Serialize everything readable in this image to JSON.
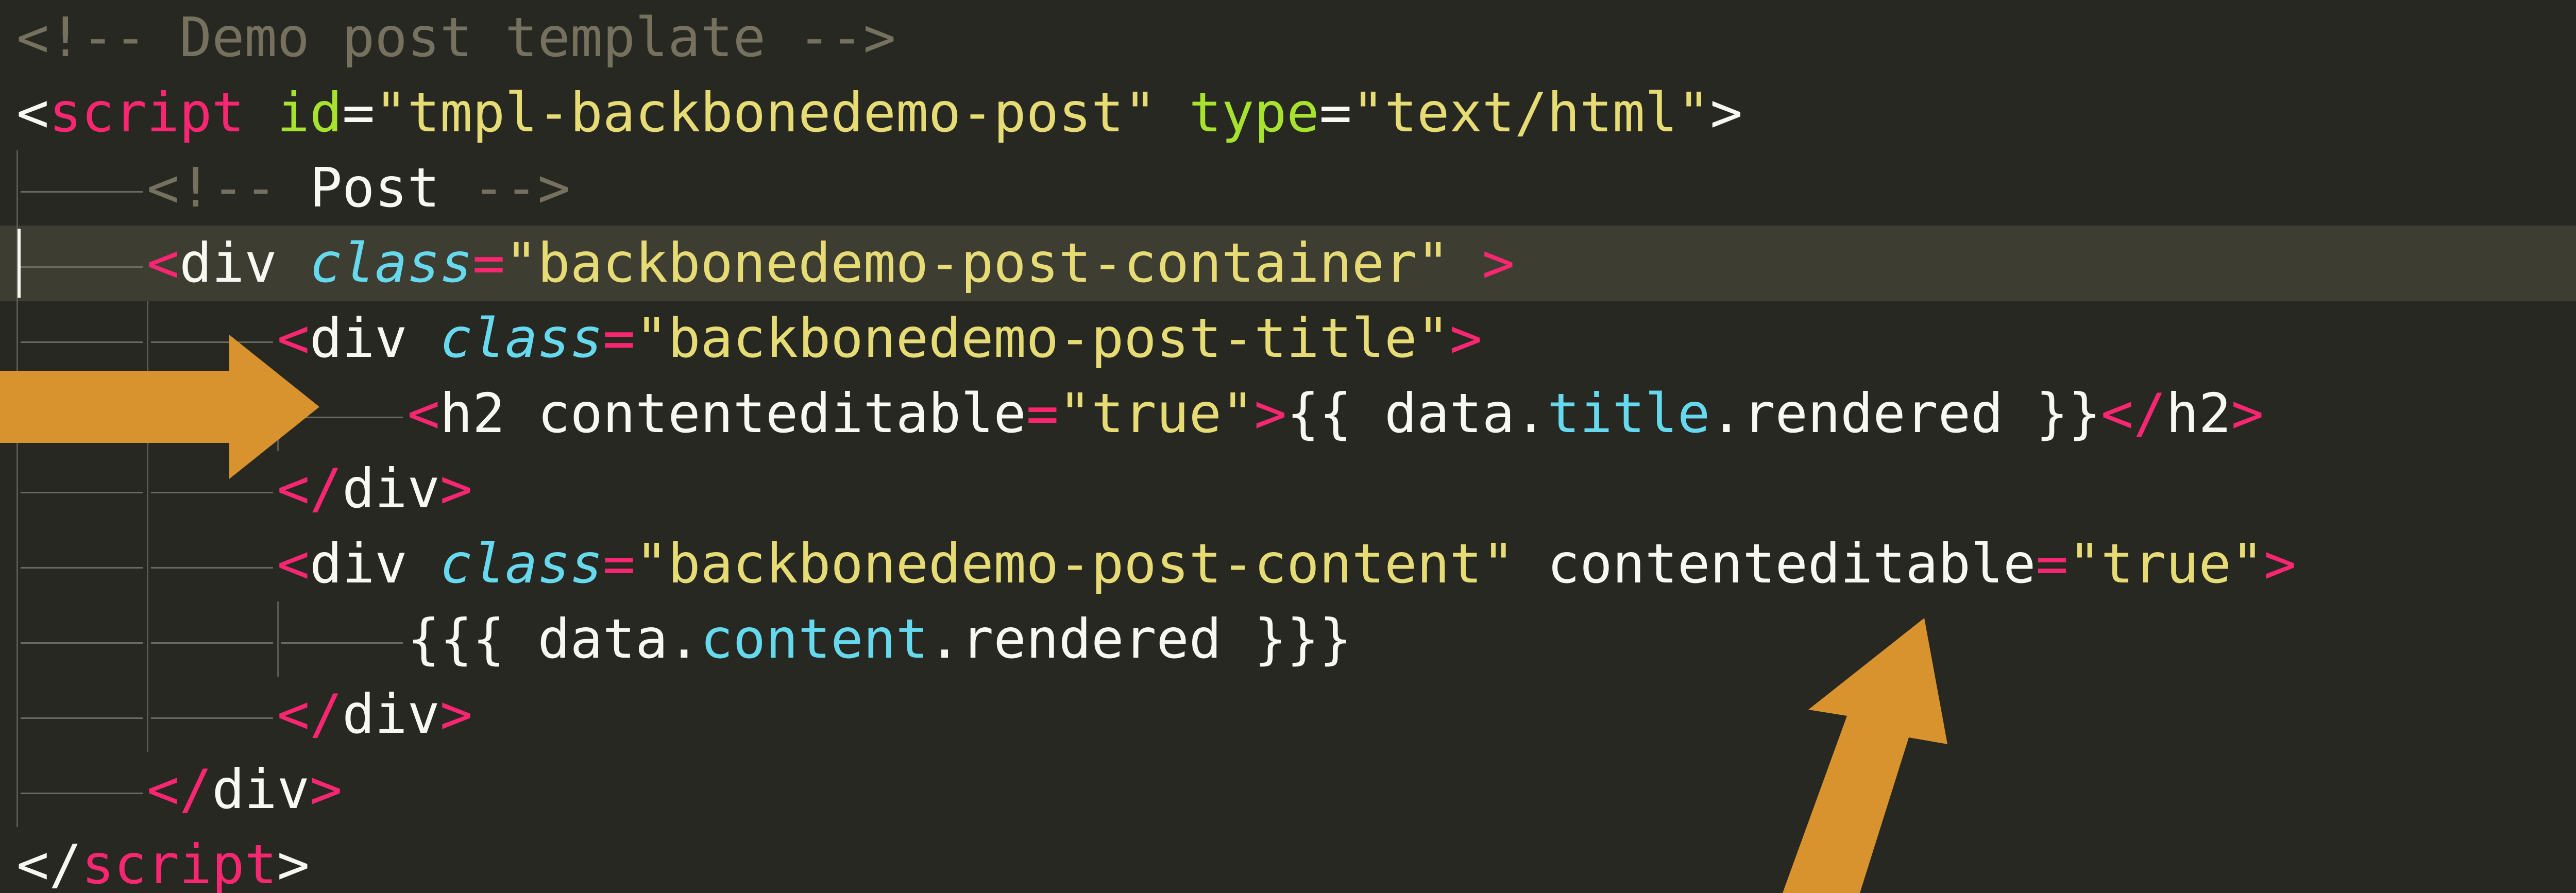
{
  "editor": {
    "theme_colors": {
      "background": "#272822",
      "comment": "#75715e",
      "tag": "#f92672",
      "attribute": "#a6e22e",
      "string": "#e6db74",
      "class_keyword": "#66d9ef",
      "text": "#f8f8f2",
      "annotation_arrow": "#d8922e"
    },
    "lines": [
      {
        "tokens": [
          {
            "t": "cmt",
            "v": "<!-- Demo post template -->"
          }
        ]
      },
      {
        "tokens": [
          {
            "t": "pl",
            "v": "<"
          },
          {
            "t": "tag",
            "v": "script"
          },
          {
            "t": "pl",
            "v": " "
          },
          {
            "t": "attr",
            "v": "id"
          },
          {
            "t": "pl",
            "v": "="
          },
          {
            "t": "str",
            "v": "\"tmpl-backbonedemo-post\""
          },
          {
            "t": "pl",
            "v": " "
          },
          {
            "t": "attr",
            "v": "type"
          },
          {
            "t": "pl",
            "v": "="
          },
          {
            "t": "str",
            "v": "\"text/html\""
          },
          {
            "t": "pl",
            "v": ">"
          }
        ]
      },
      {
        "tokens": [
          {
            "t": "pl",
            "v": "    "
          },
          {
            "t": "cmt",
            "v": "<!-- "
          },
          {
            "t": "pl",
            "v": "Post"
          },
          {
            "t": "cmt",
            "v": " -->"
          }
        ]
      },
      {
        "active": true,
        "tokens": [
          {
            "t": "pl",
            "v": "    "
          },
          {
            "t": "tag",
            "v": "<"
          },
          {
            "t": "pl",
            "v": "div "
          },
          {
            "t": "cls",
            "v": "class"
          },
          {
            "t": "tag",
            "v": "="
          },
          {
            "t": "str",
            "v": "\"backbonedemo-post-container\""
          },
          {
            "t": "pl",
            "v": " "
          },
          {
            "t": "tag",
            "v": ">"
          }
        ]
      },
      {
        "tokens": [
          {
            "t": "pl",
            "v": "        "
          },
          {
            "t": "tag",
            "v": "<"
          },
          {
            "t": "pl",
            "v": "div "
          },
          {
            "t": "cls",
            "v": "class"
          },
          {
            "t": "tag",
            "v": "="
          },
          {
            "t": "str",
            "v": "\"backbonedemo-post-title\""
          },
          {
            "t": "tag",
            "v": ">"
          }
        ]
      },
      {
        "tokens": [
          {
            "t": "pl",
            "v": "            "
          },
          {
            "t": "tag",
            "v": "<"
          },
          {
            "t": "pl",
            "v": "h2 contenteditable"
          },
          {
            "t": "tag",
            "v": "="
          },
          {
            "t": "str",
            "v": "\"true\""
          },
          {
            "t": "tag",
            "v": ">"
          },
          {
            "t": "pl",
            "v": "{{ data."
          },
          {
            "t": "prop",
            "v": "title"
          },
          {
            "t": "pl",
            "v": ".rendered }}"
          },
          {
            "t": "tag",
            "v": "</"
          },
          {
            "t": "pl",
            "v": "h2"
          },
          {
            "t": "tag",
            "v": ">"
          }
        ]
      },
      {
        "tokens": [
          {
            "t": "pl",
            "v": "        "
          },
          {
            "t": "tag",
            "v": "</"
          },
          {
            "t": "pl",
            "v": "div"
          },
          {
            "t": "tag",
            "v": ">"
          }
        ]
      },
      {
        "tokens": [
          {
            "t": "pl",
            "v": "        "
          },
          {
            "t": "tag",
            "v": "<"
          },
          {
            "t": "pl",
            "v": "div "
          },
          {
            "t": "cls",
            "v": "class"
          },
          {
            "t": "tag",
            "v": "="
          },
          {
            "t": "str",
            "v": "\"backbonedemo-post-content\""
          },
          {
            "t": "pl",
            "v": " contenteditable"
          },
          {
            "t": "tag",
            "v": "="
          },
          {
            "t": "str",
            "v": "\"true\""
          },
          {
            "t": "tag",
            "v": ">"
          }
        ]
      },
      {
        "tokens": [
          {
            "t": "pl",
            "v": "            {{{ data."
          },
          {
            "t": "prop",
            "v": "content"
          },
          {
            "t": "pl",
            "v": ".rendered }}}"
          }
        ]
      },
      {
        "tokens": [
          {
            "t": "pl",
            "v": "        "
          },
          {
            "t": "tag",
            "v": "</"
          },
          {
            "t": "pl",
            "v": "div"
          },
          {
            "t": "tag",
            "v": ">"
          }
        ]
      },
      {
        "tokens": [
          {
            "t": "pl",
            "v": "    "
          },
          {
            "t": "tag",
            "v": "</"
          },
          {
            "t": "pl",
            "v": "div"
          },
          {
            "t": "tag",
            "v": ">"
          }
        ]
      },
      {
        "tokens": [
          {
            "t": "pl",
            "v": "</"
          },
          {
            "t": "tag",
            "v": "script"
          },
          {
            "t": "pl",
            "v": ">"
          }
        ]
      }
    ]
  }
}
